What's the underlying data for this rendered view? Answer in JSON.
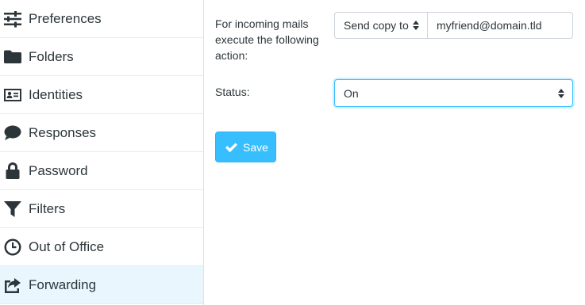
{
  "sidebar": {
    "items": [
      {
        "label": "Preferences",
        "icon": "sliders-icon"
      },
      {
        "label": "Folders",
        "icon": "folder-icon"
      },
      {
        "label": "Identities",
        "icon": "id-card-icon"
      },
      {
        "label": "Responses",
        "icon": "comment-icon"
      },
      {
        "label": "Password",
        "icon": "lock-icon"
      },
      {
        "label": "Filters",
        "icon": "filter-icon"
      },
      {
        "label": "Out of Office",
        "icon": "clock-icon"
      },
      {
        "label": "Forwarding",
        "icon": "share-icon",
        "active": true
      }
    ]
  },
  "form": {
    "action_label": "For incoming mails exe­cute the following action:",
    "action_select_value": "Send copy to",
    "target_email_value": "myfriend@domain.tld",
    "status_label": "Status:",
    "status_select_value": "On",
    "save_label": "Save"
  },
  "colors": {
    "accent": "#37beff",
    "active_item_bg": "#e9f6fd",
    "text": "#2c363a"
  }
}
